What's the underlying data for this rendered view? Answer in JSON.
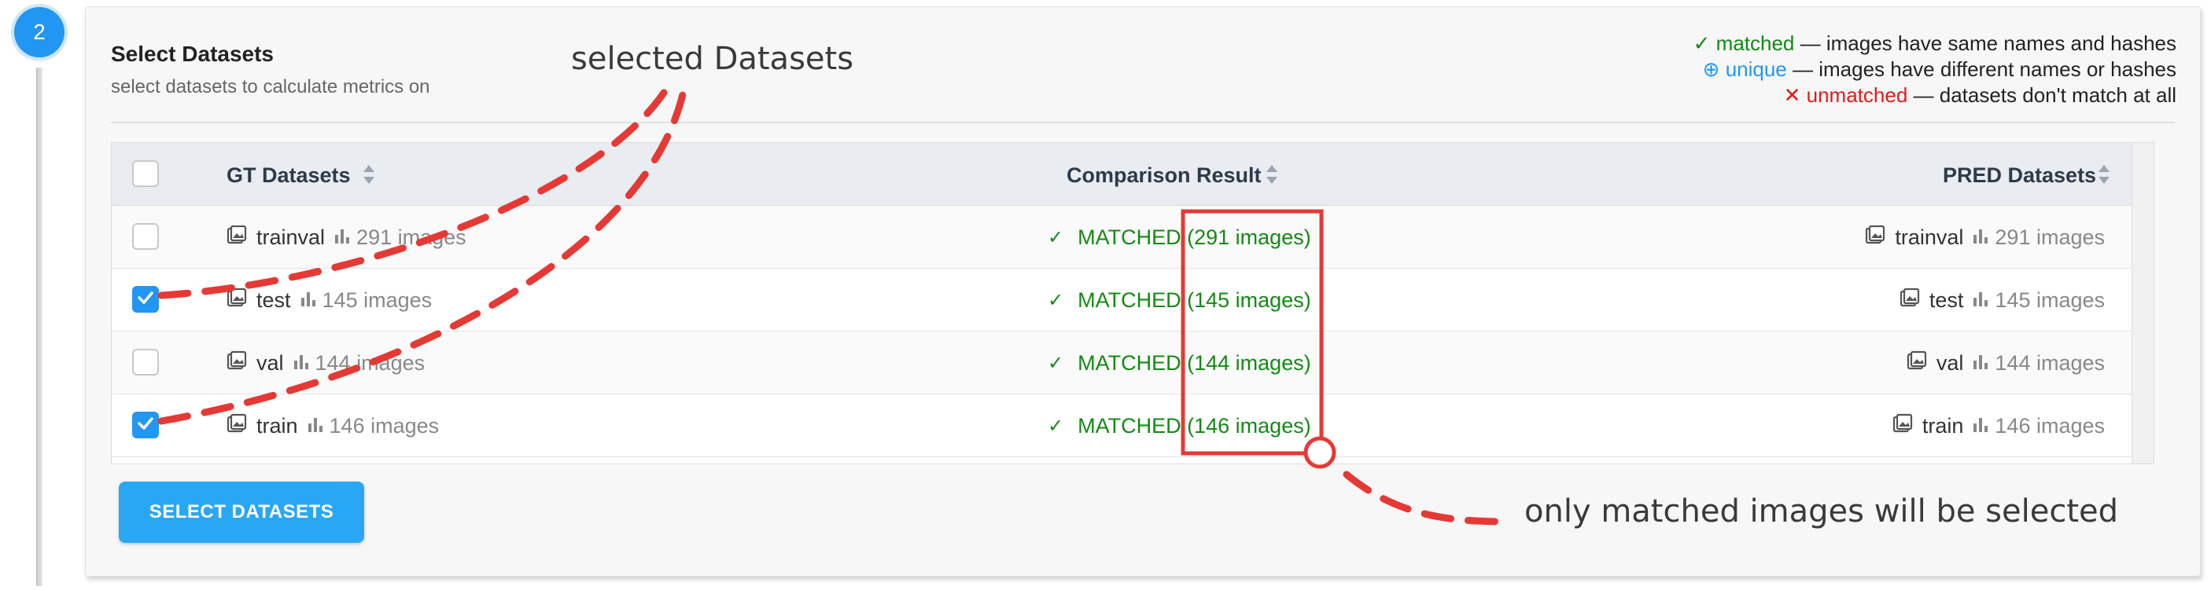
{
  "step": {
    "number": "2"
  },
  "card": {
    "title": "Select Datasets",
    "description": "select datasets to calculate metrics on"
  },
  "legend": {
    "matched": {
      "icon": "check-icon",
      "label": "matched",
      "text": " — images have same names and hashes",
      "color": "#138a13"
    },
    "unique": {
      "icon": "plus-circle-icon",
      "label": "unique",
      "text": " — images have different names or hashes",
      "color": "#2196f3"
    },
    "unmatched": {
      "icon": "cross-icon",
      "label": "unmatched",
      "text": " — datasets don't match at all",
      "color": "#e01b1b"
    }
  },
  "table": {
    "headers": {
      "gt": "GT Datasets",
      "comparison": "Comparison Result",
      "pred": "PRED Datasets"
    },
    "rows": [
      {
        "checked": false,
        "gt_name": "trainval",
        "gt_count": "291 images",
        "status": "MATCHED",
        "match_count": "(291 images)",
        "pred_name": "trainval",
        "pred_count": "291 images"
      },
      {
        "checked": true,
        "gt_name": "test",
        "gt_count": "145 images",
        "status": "MATCHED",
        "match_count": "(145 images)",
        "pred_name": "test",
        "pred_count": "145 images"
      },
      {
        "checked": false,
        "gt_name": "val",
        "gt_count": "144 images",
        "status": "MATCHED",
        "match_count": "(144 images)",
        "pred_name": "val",
        "pred_count": "144 images"
      },
      {
        "checked": true,
        "gt_name": "train",
        "gt_count": "146 images",
        "status": "MATCHED",
        "match_count": "(146 images)",
        "pred_name": "train",
        "pred_count": "146 images"
      }
    ]
  },
  "button": {
    "label": "SELECT DATASETS"
  },
  "annotations": {
    "top": "selected Datasets",
    "bottom": "only matched images will be selected",
    "color": "#e53935"
  },
  "colors": {
    "accent": "#2196f3",
    "matched": "#138a13"
  }
}
